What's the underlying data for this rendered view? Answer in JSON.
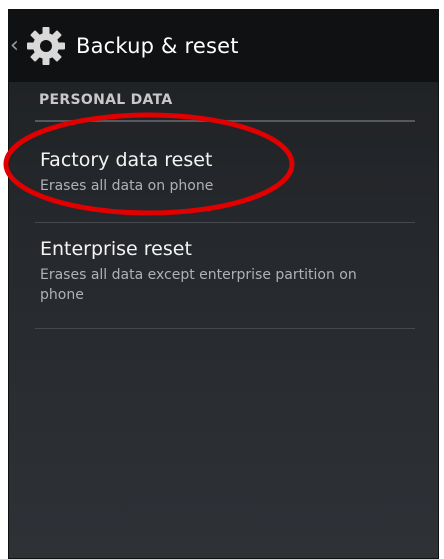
{
  "action_bar": {
    "back_glyph": "‹",
    "title": "Backup & reset",
    "icon": "gear-icon"
  },
  "section": {
    "label": "PERSONAL DATA"
  },
  "items": [
    {
      "title": "Factory data reset",
      "summary": "Erases all data on phone"
    },
    {
      "title": "Enterprise reset",
      "summary": "Erases all data except enterprise partition on phone"
    }
  ],
  "colors": {
    "background": "#25282c",
    "action_bar": "#101113",
    "annotation": "#e00000"
  }
}
